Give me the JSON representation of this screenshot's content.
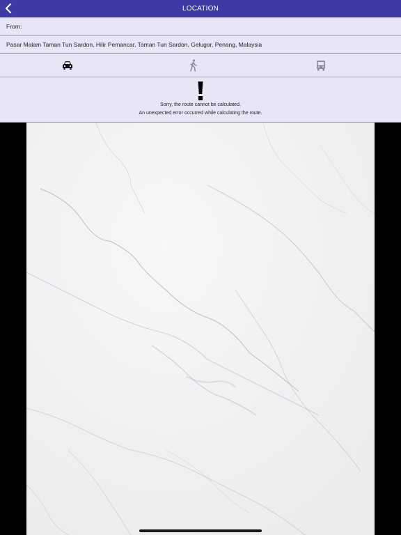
{
  "navbar": {
    "title": "LOCATION",
    "back_icon": "chevron-left-icon"
  },
  "route": {
    "from_label": "From:",
    "to_value": "Pasar Malam Taman Tun Sardon, Hilir Pemancar, Taman Tun Sardon, Gelugor, Penang, Malaysia"
  },
  "modes": [
    {
      "name": "car",
      "icon": "car-icon",
      "selected": true
    },
    {
      "name": "walk",
      "icon": "walking-icon",
      "selected": false
    },
    {
      "name": "bus",
      "icon": "bus-icon",
      "selected": false
    }
  ],
  "error": {
    "icon": "exclamation-icon",
    "line1": "Sorry, the route cannot be calculated.",
    "line2": "An unexpected error occurred while calculating the route."
  },
  "colors": {
    "navbar": "#3d3aa6",
    "panel": "#e7e6f6",
    "divider": "#9c9cae",
    "selected_mode": "#111111",
    "unselected_mode": "#8a8a9a"
  }
}
